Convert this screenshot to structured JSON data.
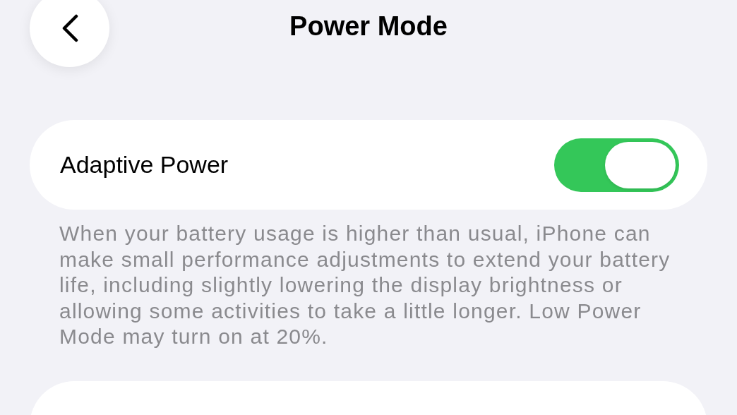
{
  "navigation": {
    "title": "Power Mode"
  },
  "settings": [
    {
      "kind": "toggle",
      "label": "Adaptive Power",
      "on": true,
      "footer": "When your battery usage is higher than usual, iPhone can make small performance adjustments to extend your battery life, including slightly lowering the display brightness or allowing some activities to take a little longer. Low Power Mode may turn on at 20%."
    },
    {
      "kind": "partial"
    }
  ]
}
